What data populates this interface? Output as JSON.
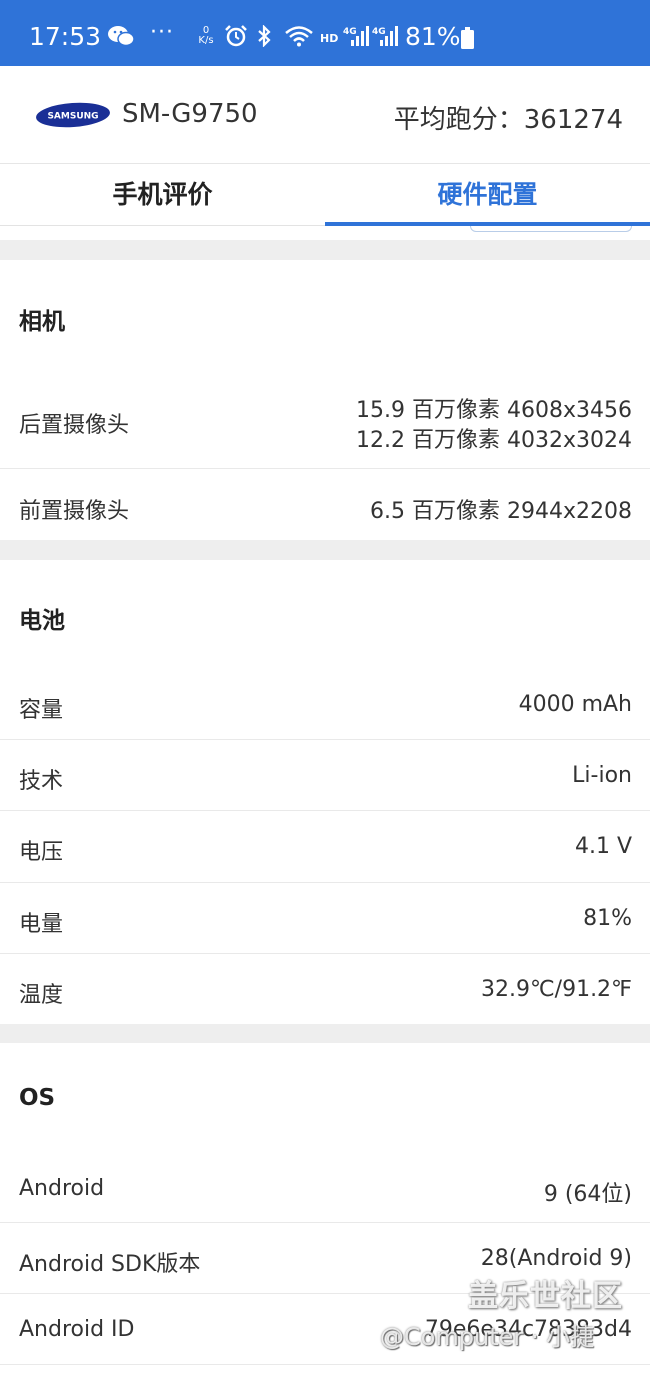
{
  "status_bar": {
    "time": "17:53",
    "dots": "···",
    "speed_value": "0",
    "speed_unit": "K/s",
    "hd": "HD",
    "battery_text": "81%"
  },
  "header": {
    "brand": "SAMSUNG",
    "model": "SM-G9750",
    "score": "平均跑分：361274"
  },
  "tabs": [
    {
      "label": "手机评价",
      "active": false
    },
    {
      "label": "硬件配置",
      "active": true
    }
  ],
  "sections": {
    "camera": {
      "title": "相机",
      "rows": [
        {
          "label": "后置摄像头",
          "value_1": "15.9 百万像素 4608x3456",
          "value_2": "12.2 百万像素 4032x3024"
        },
        {
          "label": "前置摄像头",
          "value": "6.5 百万像素 2944x2208"
        }
      ]
    },
    "battery": {
      "title": "电池",
      "rows": [
        {
          "label": "容量",
          "value": "4000 mAh"
        },
        {
          "label": "技术",
          "value": "Li-ion"
        },
        {
          "label": "电压",
          "value": "4.1 V"
        },
        {
          "label": "电量",
          "value": "81%"
        },
        {
          "label": "温度",
          "value": "32.9℃/91.2℉"
        }
      ]
    },
    "os": {
      "title": "OS",
      "rows": [
        {
          "label": "Android",
          "value": "9 (64位)"
        },
        {
          "label": "Android SDK版本",
          "value": "28(Android 9)"
        },
        {
          "label": "Android ID",
          "value": "79e6e34c78383d4"
        }
      ]
    }
  },
  "watermark": {
    "site": "盖乐世社区",
    "user": "@Computer · 小捷"
  },
  "colors": {
    "status_bar": "#2f73d8",
    "accent": "#2f73d8",
    "section_gap": "#eeeeee"
  }
}
